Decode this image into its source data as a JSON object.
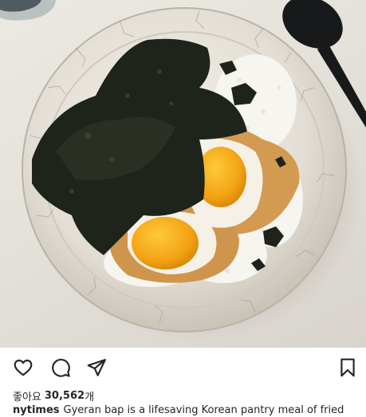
{
  "post": {
    "image_alt": "",
    "actions": {
      "like_icon": "heart-icon",
      "comment_icon": "comment-bubble-icon",
      "share_icon": "send-paper-plane-icon",
      "save_icon": "bookmark-icon"
    },
    "likes": {
      "label": "좋아요",
      "count": "30,562",
      "suffix": "개"
    },
    "caption": {
      "username": "nytimes",
      "text": "Gyeran bap is a lifesaving Korean pantry meal of fried"
    }
  },
  "colors": {
    "icon": "#262626",
    "text": "#262626",
    "background": "#ffffff",
    "bowl_rim": "#e6e2da",
    "seaweed": "#1f241c",
    "yolk": "#f0a416"
  }
}
